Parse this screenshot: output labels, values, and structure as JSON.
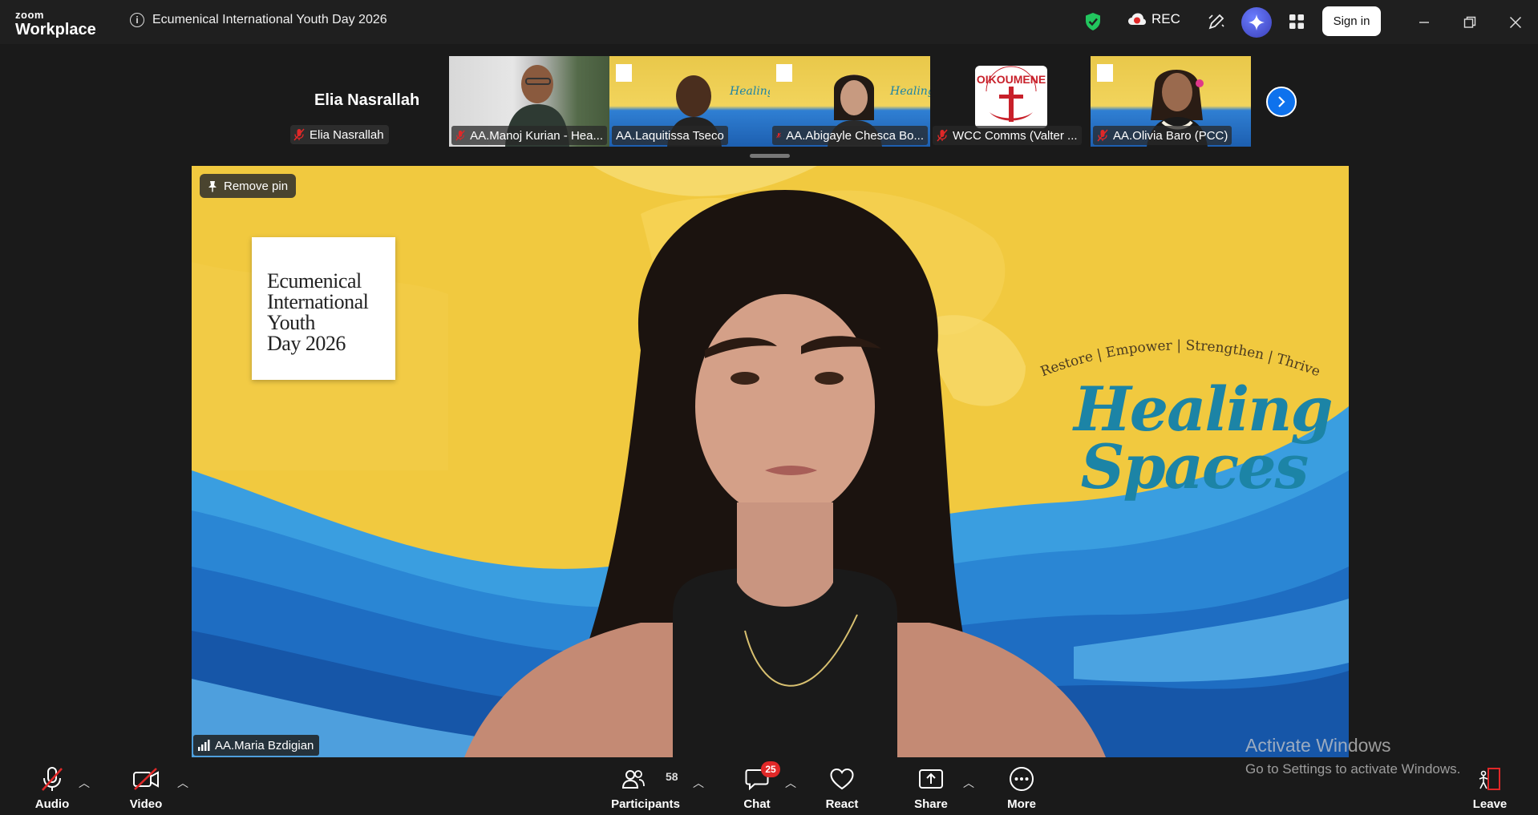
{
  "titlebar": {
    "brand_top": "zoom",
    "brand_bottom": "Workplace",
    "meeting_title": "Ecumenical International Youth Day 2026",
    "rec_label": "REC",
    "signin_label": "Sign in"
  },
  "strip": {
    "active_speaker_name": "Elia Nasrallah",
    "active_speaker_tag": "Elia Nasrallah",
    "thumbnails": [
      {
        "name": "AA.Manoj Kurian - Hea...",
        "muted": true
      },
      {
        "name": "AA.Laquitissa Tseco",
        "muted": false
      },
      {
        "name": "AA.Abigayle Chesca Bo...",
        "muted": true
      },
      {
        "name": "WCC Comms (Valter ...",
        "muted": true
      },
      {
        "name": "AA.Olivia Baro (PCC)",
        "muted": true
      }
    ],
    "oikoumene_text": "OIKOUMENE"
  },
  "main": {
    "remove_pin_label": "Remove pin",
    "logo_lines": [
      "Ecumenical",
      "International",
      "Youth",
      "Day 2026"
    ],
    "tagline": "Restore | Empower | Strengthen | Thrive",
    "healing_line1": "Healing",
    "healing_line2": "Spaces",
    "participant_name": "AA.Maria Bzdigian"
  },
  "watermark": {
    "line1": "Activate Windows",
    "line2": "Go to Settings to activate Windows."
  },
  "toolbar": {
    "audio_label": "Audio",
    "video_label": "Video",
    "participants_label": "Participants",
    "participants_count": "58",
    "chat_label": "Chat",
    "chat_badge": "25",
    "react_label": "React",
    "share_label": "Share",
    "more_label": "More",
    "leave_label": "Leave"
  },
  "colors": {
    "accent_blue": "#0e72ed",
    "badge_red": "#e02828",
    "shield_green": "#22c55e",
    "healing_teal": "#1c84a6"
  }
}
